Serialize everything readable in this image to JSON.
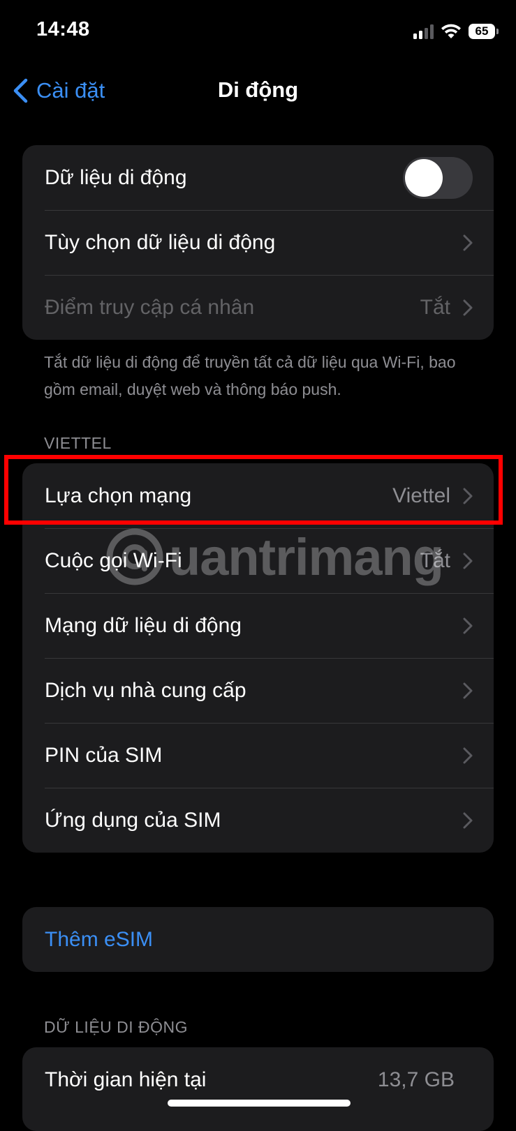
{
  "status_bar": {
    "time": "14:48",
    "battery_level": "65",
    "signal_bars_active": 2,
    "signal_bars_total": 4
  },
  "nav": {
    "back_label": "Cài đặt",
    "title": "Di động"
  },
  "group_main": {
    "cellular_data": {
      "label": "Dữ liệu di động",
      "toggle_on": false
    },
    "cellular_options": {
      "label": "Tùy chọn dữ liệu di động"
    },
    "personal_hotspot": {
      "label": "Điểm truy cập cá nhân",
      "value": "Tắt"
    }
  },
  "footnote": "Tắt dữ liệu di động để truyền tất cả dữ liệu qua Wi-Fi, bao gồm email, duyệt web và thông báo push.",
  "carrier_section": {
    "header": "VIETTEL",
    "items": [
      {
        "label": "Lựa chọn mạng",
        "value": "Viettel"
      },
      {
        "label": "Cuộc gọi Wi-Fi",
        "value": "Tắt"
      },
      {
        "label": "Mạng dữ liệu di động",
        "value": ""
      },
      {
        "label": "Dịch vụ nhà cung cấp",
        "value": ""
      },
      {
        "label": "PIN của SIM",
        "value": ""
      },
      {
        "label": "Ứng dụng của SIM",
        "value": ""
      }
    ]
  },
  "esim": {
    "label": "Thêm eSIM"
  },
  "usage_section": {
    "header": "DỮ LIỆU DI ĐỘNG",
    "current_period": {
      "label": "Thời gian hiện tại",
      "value": "13,7 GB"
    }
  },
  "watermark": {
    "text": "uantrimang"
  },
  "colors": {
    "background": "#000000",
    "cell": "#1c1c1e",
    "separator": "#38383a",
    "accent_blue": "#3b8ff5",
    "secondary_text": "#8e8e93",
    "highlight_red": "#ff0000"
  }
}
